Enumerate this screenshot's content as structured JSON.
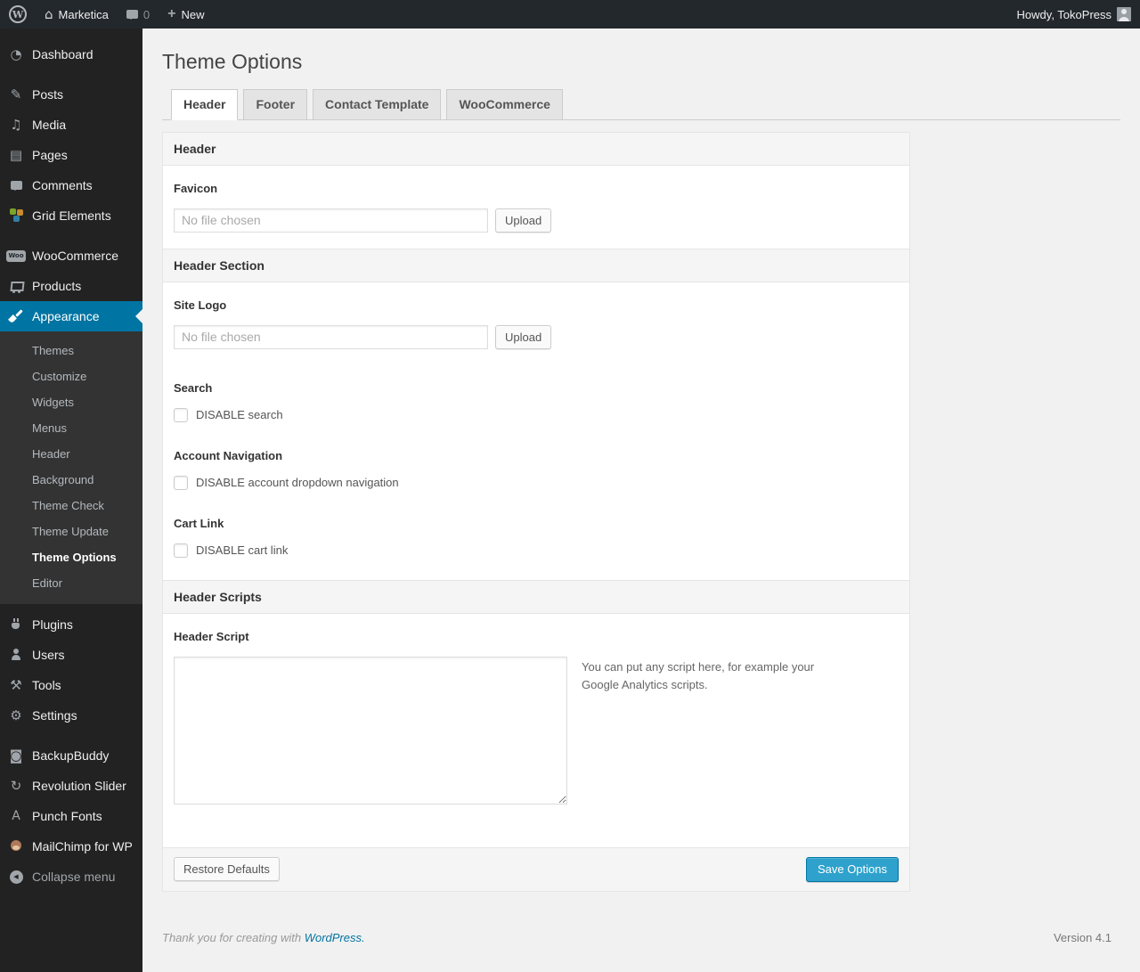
{
  "colors": {
    "admin_bar_bg": "#23282d",
    "menu_bg": "#222222",
    "submenu_bg": "#333333",
    "menu_highlight": "#0074a2",
    "primary_button": "#2ea2cc",
    "link": "#0074a2",
    "body_bg": "#f1f1f1"
  },
  "admin_bar": {
    "site_name": "Marketica",
    "comment_count": "0",
    "new_label": "New",
    "howdy": "Howdy, TokoPress"
  },
  "sidebar": {
    "woo_badge_text": "Woo",
    "punch_fonts_glyph": "A",
    "items": [
      {
        "label": "Dashboard",
        "icon": "dashboard-icon"
      },
      {
        "label": "Posts",
        "icon": "pushpin-icon"
      },
      {
        "label": "Media",
        "icon": "media-icon"
      },
      {
        "label": "Pages",
        "icon": "pages-icon"
      },
      {
        "label": "Comments",
        "icon": "comment-bubble-icon"
      },
      {
        "label": "Grid Elements",
        "icon": "grid-elements-icon"
      },
      {
        "label": "WooCommerce",
        "icon": "woocommerce-badge-icon"
      },
      {
        "label": "Products",
        "icon": "cart-icon"
      },
      {
        "label": "Appearance",
        "icon": "paintbrush-icon",
        "active": true
      },
      {
        "label": "Plugins",
        "icon": "plug-icon"
      },
      {
        "label": "Users",
        "icon": "person-icon"
      },
      {
        "label": "Tools",
        "icon": "tools-icon"
      },
      {
        "label": "Settings",
        "icon": "settings-icon"
      },
      {
        "label": "BackupBuddy",
        "icon": "backup-drive-icon"
      },
      {
        "label": "Revolution Slider",
        "icon": "refresh-icon"
      },
      {
        "label": "Punch Fonts",
        "icon": "letter-a-icon"
      },
      {
        "label": "MailChimp for WP",
        "icon": "monkey-icon"
      },
      {
        "label": "Collapse menu",
        "icon": "collapse-arrow-icon"
      }
    ],
    "appearance_submenu": [
      {
        "label": "Themes"
      },
      {
        "label": "Customize"
      },
      {
        "label": "Widgets"
      },
      {
        "label": "Menus"
      },
      {
        "label": "Header"
      },
      {
        "label": "Background"
      },
      {
        "label": "Theme Check"
      },
      {
        "label": "Theme Update"
      },
      {
        "label": "Theme Options",
        "current": true
      },
      {
        "label": "Editor"
      }
    ]
  },
  "page": {
    "title": "Theme Options",
    "tabs": [
      {
        "label": "Header",
        "active": true
      },
      {
        "label": "Footer",
        "active": false
      },
      {
        "label": "Contact Template",
        "active": false
      },
      {
        "label": "WooCommerce",
        "active": false
      }
    ]
  },
  "form": {
    "sections": [
      {
        "title": "Header"
      },
      {
        "title": "Header Section"
      },
      {
        "title": "Header Scripts"
      }
    ],
    "favicon": {
      "label": "Favicon",
      "placeholder": "No file chosen",
      "upload_label": "Upload"
    },
    "site_logo": {
      "label": "Site Logo",
      "placeholder": "No file chosen",
      "upload_label": "Upload"
    },
    "search": {
      "label": "Search",
      "checkbox_label": "DISABLE search",
      "checked": false
    },
    "account_navigation": {
      "label": "Account Navigation",
      "checkbox_label": "DISABLE account dropdown navigation",
      "checked": false
    },
    "cart_link": {
      "label": "Cart Link",
      "checkbox_label": "DISABLE cart link",
      "checked": false
    },
    "header_script": {
      "label": "Header Script",
      "value": "",
      "hint": "You can put any script here, for example your Google Analytics scripts."
    },
    "restore_label": "Restore Defaults",
    "save_label": "Save Options"
  },
  "footer": {
    "thanks_prefix": "Thank you for creating with ",
    "link_label": "WordPress.",
    "version": "Version 4.1"
  }
}
